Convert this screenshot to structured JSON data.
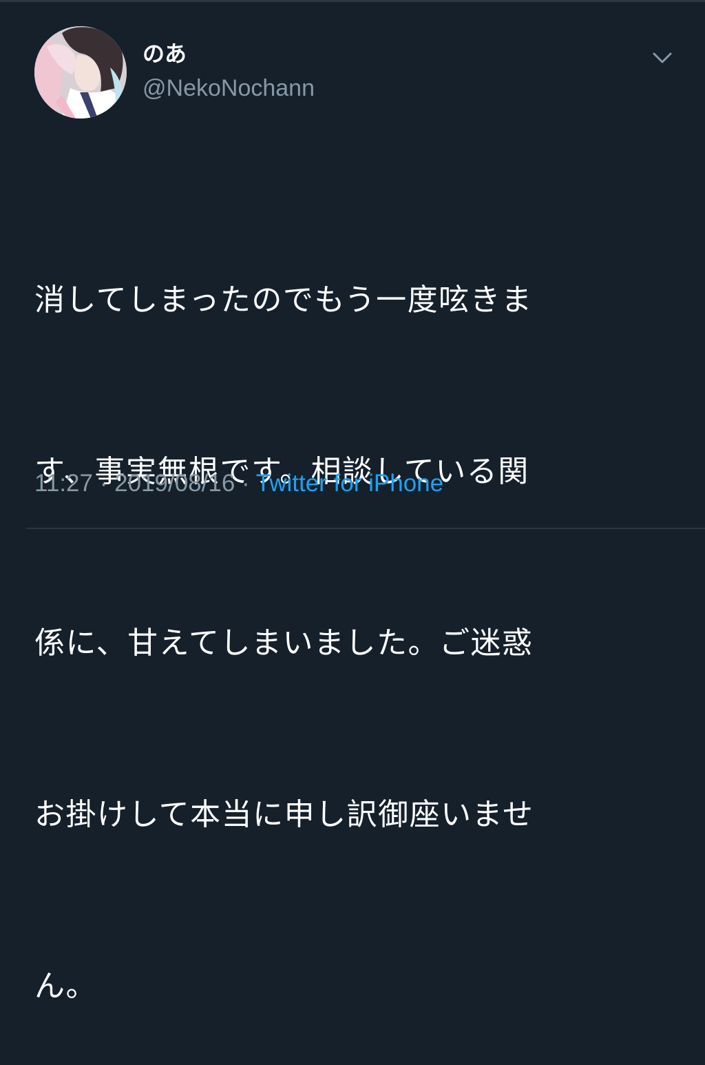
{
  "tweet": {
    "author": {
      "display_name": "のあ",
      "handle": "@NekoNochann"
    },
    "text_lines": [
      "消してしまったのでもう一度呟きま",
      "す、事実無根です。相談している関",
      "係に、甘えてしまいました。ご迷惑",
      "お掛けして本当に申し訳御座いませ",
      "ん。"
    ],
    "time": "11:27",
    "separator": " · ",
    "date": "2019/08/16",
    "source": "Twitter for iPhone",
    "menu_icon": "chevron-down-icon"
  },
  "colors": {
    "background": "#15202b",
    "text": "#ffffff",
    "secondary_text": "#8899a6",
    "link": "#1da1f2",
    "divider": "#2a3743"
  }
}
